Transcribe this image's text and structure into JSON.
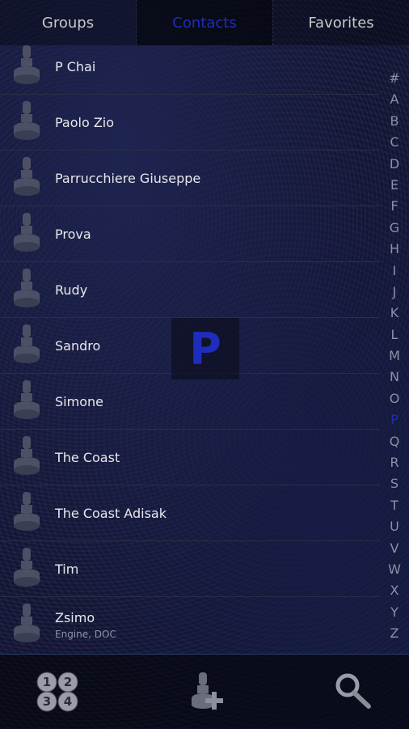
{
  "tabs": [
    {
      "label": "Groups"
    },
    {
      "label": "Contacts"
    },
    {
      "label": "Favorites"
    }
  ],
  "contacts": [
    {
      "name": "P Chai",
      "sub": ""
    },
    {
      "name": "Paolo Zio",
      "sub": ""
    },
    {
      "name": "Parrucchiere Giuseppe",
      "sub": ""
    },
    {
      "name": "Prova",
      "sub": ""
    },
    {
      "name": "Rudy",
      "sub": ""
    },
    {
      "name": "Sandro",
      "sub": ""
    },
    {
      "name": "Simone",
      "sub": ""
    },
    {
      "name": "The Coast",
      "sub": ""
    },
    {
      "name": "The Coast Adisak",
      "sub": ""
    },
    {
      "name": "Tim",
      "sub": ""
    },
    {
      "name": "Zsimo",
      "sub": "Engine, DOC"
    }
  ],
  "index": [
    "#",
    "A",
    "B",
    "C",
    "D",
    "E",
    "F",
    "G",
    "H",
    "I",
    "J",
    "K",
    "L",
    "M",
    "N",
    "O",
    "P",
    "Q",
    "R",
    "S",
    "T",
    "U",
    "V",
    "W",
    "X",
    "Y",
    "Z"
  ],
  "index_current": "P",
  "letter_bubble": "P",
  "bottom": {
    "dialpad_icon": "dialpad-icon",
    "add_contact_icon": "add-contact-icon",
    "search_icon": "search-icon"
  },
  "colors": {
    "accent": "#1e2dbb",
    "text": "#e8e8ec",
    "muted": "#8e93a8"
  }
}
